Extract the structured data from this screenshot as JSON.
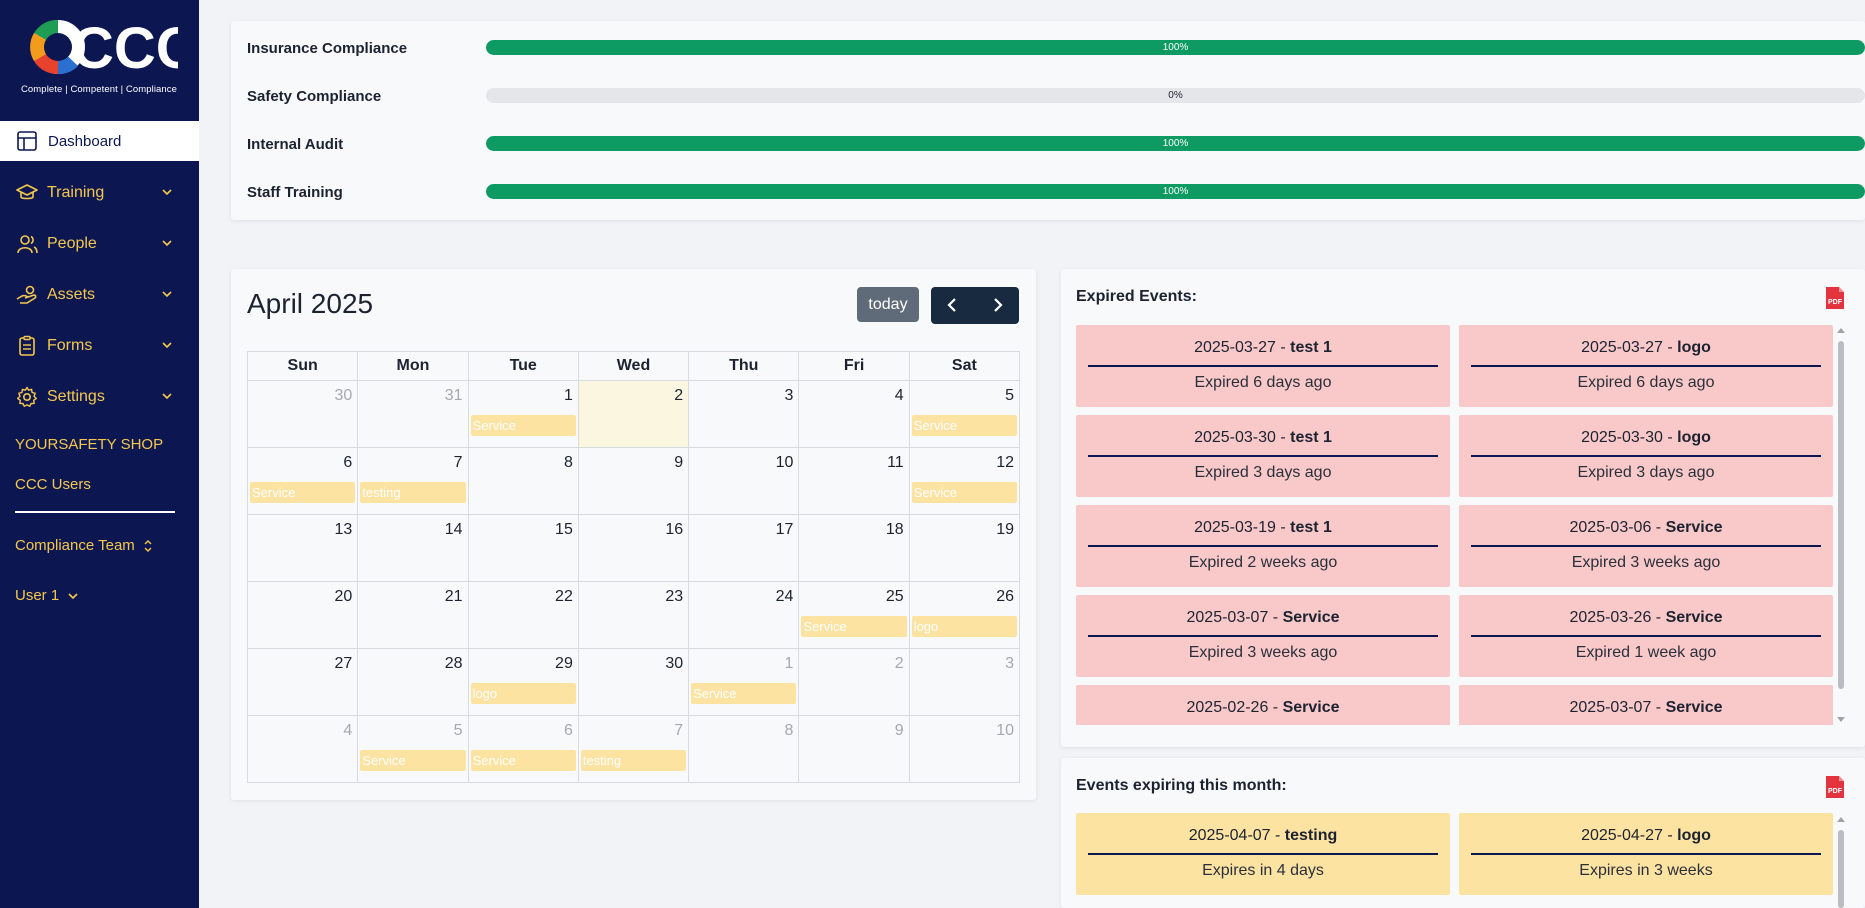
{
  "brand": {
    "logo_text": "CCC",
    "tagline": "Complete | Competent | Compliance"
  },
  "sidebar": {
    "active": {
      "label": "Dashboard",
      "icon": "dashboard-icon"
    },
    "items": [
      {
        "label": "Training",
        "icon": "graduation-cap-icon"
      },
      {
        "label": "People",
        "icon": "people-icon"
      },
      {
        "label": "Assets",
        "icon": "hand-coins-icon"
      },
      {
        "label": "Forms",
        "icon": "clipboard-icon"
      },
      {
        "label": "Settings",
        "icon": "gear-icon"
      }
    ],
    "links": [
      "YOURSAFETY SHOP",
      "CCC Users"
    ],
    "team_select": "Compliance Team",
    "user_select": "User 1"
  },
  "compliance": [
    {
      "label": "Insurance Compliance",
      "percent": 100,
      "percent_text": "100%"
    },
    {
      "label": "Safety Compliance",
      "percent": 0,
      "percent_text": "0%"
    },
    {
      "label": "Internal Audit",
      "percent": 100,
      "percent_text": "100%"
    },
    {
      "label": "Staff Training",
      "percent": 100,
      "percent_text": "100%"
    }
  ],
  "calendar": {
    "title": "April 2025",
    "today_label": "today",
    "weekdays": [
      "Sun",
      "Mon",
      "Tue",
      "Wed",
      "Thu",
      "Fri",
      "Sat"
    ],
    "weeks": [
      [
        {
          "d": "30",
          "m": true
        },
        {
          "d": "31",
          "m": true
        },
        {
          "d": "1",
          "e": "Service"
        },
        {
          "d": "2",
          "t": true
        },
        {
          "d": "3"
        },
        {
          "d": "4"
        },
        {
          "d": "5",
          "e": "Service"
        }
      ],
      [
        {
          "d": "6",
          "e": "Service"
        },
        {
          "d": "7",
          "e": "testing"
        },
        {
          "d": "8"
        },
        {
          "d": "9"
        },
        {
          "d": "10"
        },
        {
          "d": "11"
        },
        {
          "d": "12",
          "e": "Service"
        }
      ],
      [
        {
          "d": "13"
        },
        {
          "d": "14"
        },
        {
          "d": "15"
        },
        {
          "d": "16"
        },
        {
          "d": "17"
        },
        {
          "d": "18"
        },
        {
          "d": "19"
        }
      ],
      [
        {
          "d": "20"
        },
        {
          "d": "21"
        },
        {
          "d": "22"
        },
        {
          "d": "23"
        },
        {
          "d": "24"
        },
        {
          "d": "25",
          "e": "Service"
        },
        {
          "d": "26",
          "e": "logo"
        }
      ],
      [
        {
          "d": "27"
        },
        {
          "d": "28"
        },
        {
          "d": "29",
          "e": "logo"
        },
        {
          "d": "30"
        },
        {
          "d": "1",
          "m": true,
          "e": "Service"
        },
        {
          "d": "2",
          "m": true
        },
        {
          "d": "3",
          "m": true
        }
      ],
      [
        {
          "d": "4",
          "m": true
        },
        {
          "d": "5",
          "m": true,
          "e": "Service"
        },
        {
          "d": "6",
          "m": true,
          "e": "Service"
        },
        {
          "d": "7",
          "m": true,
          "e": "testing"
        },
        {
          "d": "8",
          "m": true
        },
        {
          "d": "9",
          "m": true
        },
        {
          "d": "10",
          "m": true
        }
      ]
    ]
  },
  "expired": {
    "title": "Expired Events:",
    "events": [
      {
        "date": "2025-03-27",
        "name": "test 1",
        "status": "Expired 6 days ago"
      },
      {
        "date": "2025-03-27",
        "name": "logo",
        "status": "Expired 6 days ago"
      },
      {
        "date": "2025-03-30",
        "name": "test 1",
        "status": "Expired 3 days ago"
      },
      {
        "date": "2025-03-30",
        "name": "logo",
        "status": "Expired 3 days ago"
      },
      {
        "date": "2025-03-19",
        "name": "test 1",
        "status": "Expired 2 weeks ago"
      },
      {
        "date": "2025-03-06",
        "name": "Service",
        "status": "Expired 3 weeks ago"
      },
      {
        "date": "2025-03-07",
        "name": "Service",
        "status": "Expired 3 weeks ago"
      },
      {
        "date": "2025-03-26",
        "name": "Service",
        "status": "Expired 1 week ago"
      },
      {
        "date": "2025-02-26",
        "name": "Service",
        "status": ""
      },
      {
        "date": "2025-03-07",
        "name": "Service",
        "status": ""
      }
    ]
  },
  "expiring": {
    "title": "Events expiring this month:",
    "events": [
      {
        "date": "2025-04-07",
        "name": "testing",
        "status": "Expires in 4 days"
      },
      {
        "date": "2025-04-27",
        "name": "logo",
        "status": "Expires in 3 weeks"
      }
    ]
  },
  "colors": {
    "sidebar_bg": "#0c1752",
    "accent_gold": "#f5c84c",
    "progress_green": "#0d9a63",
    "expired_card": "#f9c9ca",
    "expiring_card": "#fde3a2"
  }
}
